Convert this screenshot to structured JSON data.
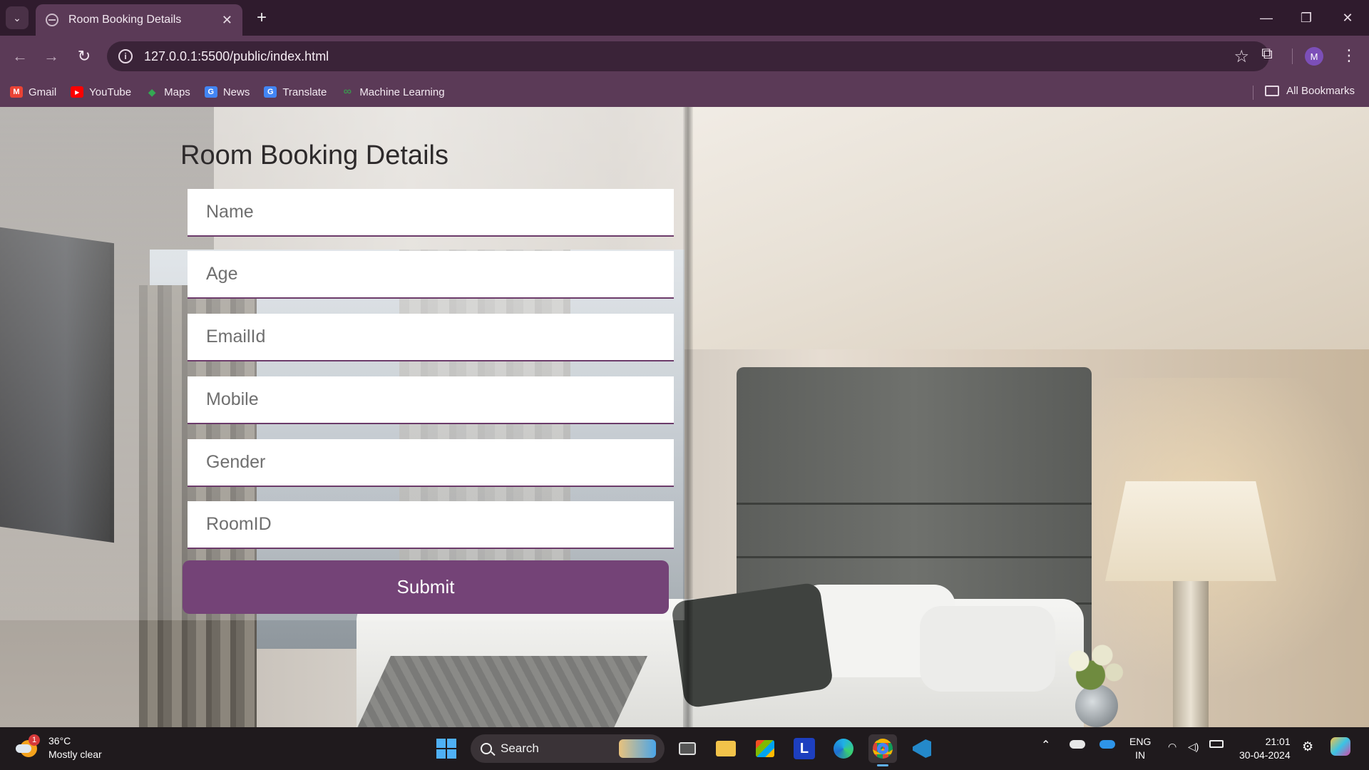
{
  "browser": {
    "tab": {
      "title": "Room Booking Details",
      "close": "✕"
    },
    "new_tab": "+",
    "window_controls": {
      "minimize": "—",
      "restore": "❐",
      "close": "✕"
    },
    "address": {
      "url": "127.0.0.1:5500/public/index.html"
    },
    "profile_initial": "M",
    "bookmarks": [
      {
        "label": "Gmail",
        "icon": "gmail-icon",
        "color": "#ea4335",
        "glyph": "M"
      },
      {
        "label": "YouTube",
        "icon": "youtube-icon",
        "color": "#ff0000",
        "glyph": "▶"
      },
      {
        "label": "Maps",
        "icon": "maps-icon",
        "color": "#34a853",
        "glyph": "◆"
      },
      {
        "label": "News",
        "icon": "news-icon",
        "color": "#4285f4",
        "glyph": "G"
      },
      {
        "label": "Translate",
        "icon": "translate-icon",
        "color": "#4285f4",
        "glyph": "G"
      },
      {
        "label": "Machine Learning",
        "icon": "ml-icon",
        "color": "#3d8f4f",
        "glyph": "∞"
      }
    ],
    "all_bookmarks_label": "All Bookmarks"
  },
  "page": {
    "heading": "Room Booking Details",
    "fields": {
      "name": {
        "placeholder": "Name",
        "value": ""
      },
      "age": {
        "placeholder": "Age",
        "value": ""
      },
      "email": {
        "placeholder": "EmailId",
        "value": ""
      },
      "mobile": {
        "placeholder": "Mobile",
        "value": ""
      },
      "gender": {
        "placeholder": "Gender",
        "value": ""
      },
      "roomid": {
        "placeholder": "RoomID",
        "value": ""
      }
    },
    "submit_label": "Submit",
    "colors": {
      "accent": "#744377",
      "field_border": "#6c3b6a"
    }
  },
  "taskbar": {
    "weather": {
      "temp": "36°C",
      "condition": "Mostly clear",
      "badge": "1"
    },
    "search_label": "Search",
    "tray": {
      "lang_top": "ENG",
      "lang_bottom": "IN",
      "time": "21:01",
      "date": "30-04-2024"
    },
    "app_letter": "L"
  }
}
